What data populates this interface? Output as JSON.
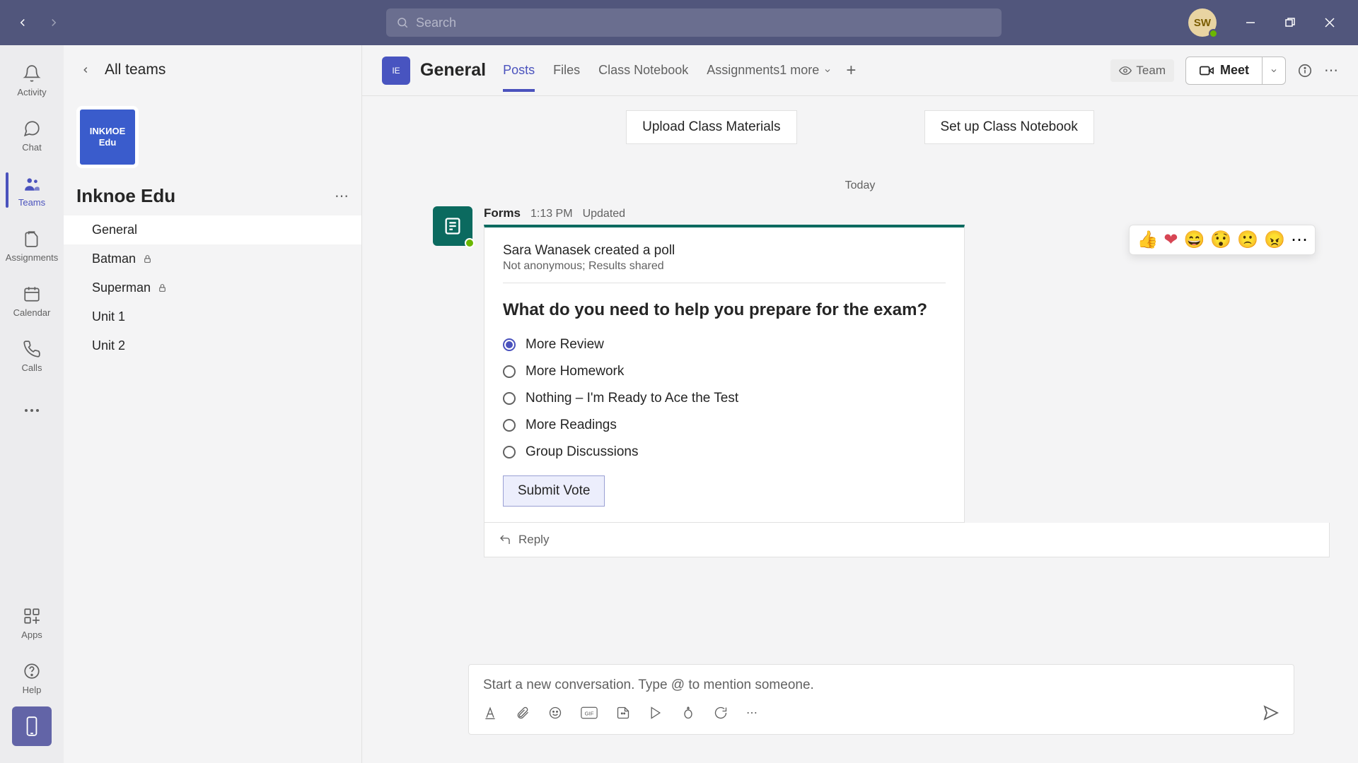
{
  "titlebar": {
    "search_placeholder": "Search",
    "user_initials": "SW"
  },
  "rail": {
    "activity": "Activity",
    "chat": "Chat",
    "teams": "Teams",
    "assignments": "Assignments",
    "calendar": "Calendar",
    "calls": "Calls",
    "apps": "Apps",
    "help": "Help"
  },
  "teams_col": {
    "all_teams": "All teams",
    "team_logo_line1": "INKИOE",
    "team_logo_line2": "Edu",
    "team_name": "Inknoe Edu",
    "channels": [
      {
        "label": "General",
        "active": true,
        "locked": false
      },
      {
        "label": "Batman",
        "active": false,
        "locked": true
      },
      {
        "label": "Superman",
        "active": false,
        "locked": true
      },
      {
        "label": "Unit 1",
        "active": false,
        "locked": false
      },
      {
        "label": "Unit 2",
        "active": false,
        "locked": false
      }
    ]
  },
  "content_header": {
    "channel_initial": "IE",
    "channel_title": "General",
    "tabs": [
      {
        "label": "Posts",
        "active": true
      },
      {
        "label": "Files",
        "active": false
      },
      {
        "label": "Class Notebook",
        "active": false
      },
      {
        "label": "Assignments",
        "active": false
      }
    ],
    "more_tabs": "1 more",
    "team_label": "Team",
    "meet_label": "Meet"
  },
  "quick_actions": {
    "upload": "Upload Class Materials",
    "setup": "Set up Class Notebook"
  },
  "date_separator": "Today",
  "reactions": [
    "👍",
    "❤",
    "😄",
    "😯",
    "🙁",
    "😠",
    "⋯"
  ],
  "post": {
    "app_name": "Forms",
    "time": "1:13 PM",
    "updated": "Updated",
    "created_by": "Sara Wanasek created a poll",
    "anon_note": "Not anonymous; Results shared",
    "question": "What do you need to help you prepare for the exam?",
    "options": [
      {
        "label": "More Review",
        "selected": true
      },
      {
        "label": "More Homework",
        "selected": false
      },
      {
        "label": "Nothing – I'm Ready to Ace the Test",
        "selected": false
      },
      {
        "label": "More Readings",
        "selected": false
      },
      {
        "label": "Group Discussions",
        "selected": false
      }
    ],
    "submit_label": "Submit Vote",
    "reply_label": "Reply"
  },
  "composer": {
    "placeholder": "Start a new conversation. Type @ to mention someone."
  }
}
